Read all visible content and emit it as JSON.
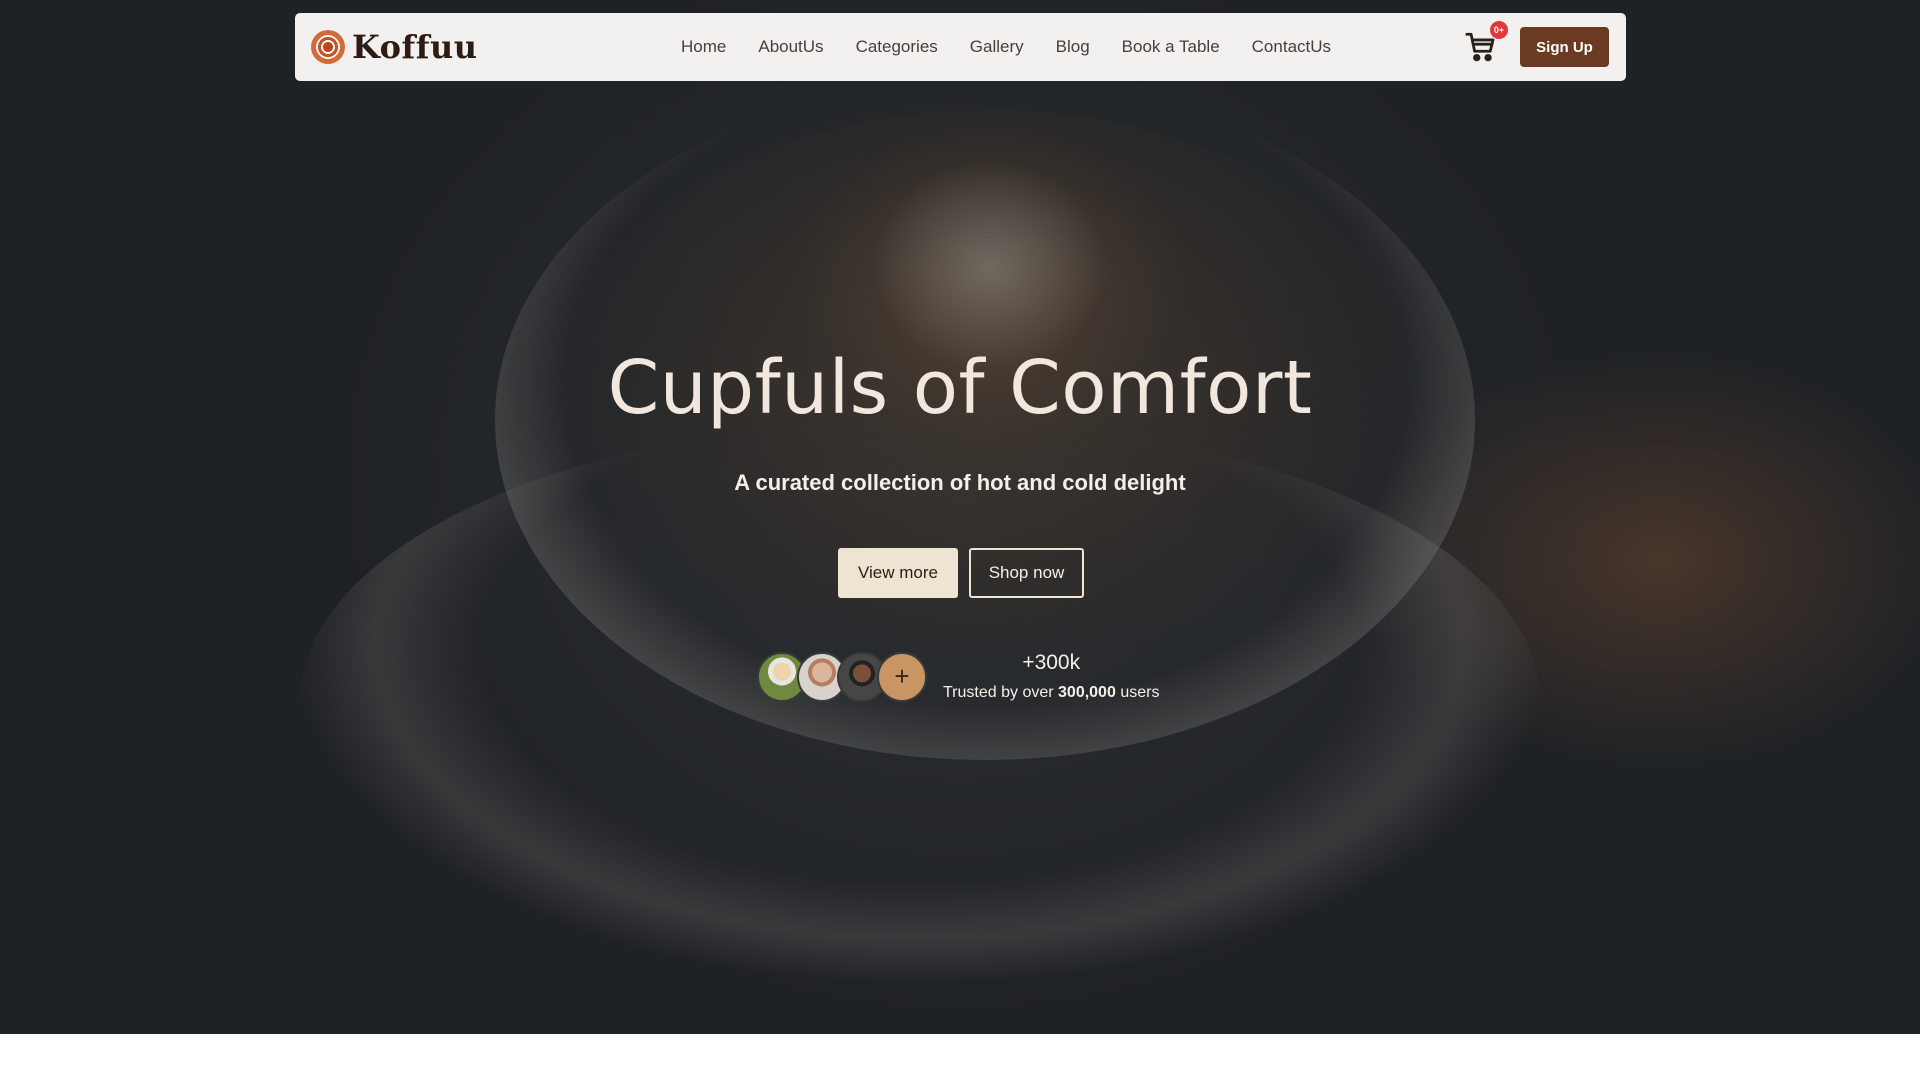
{
  "brand": {
    "name": "Koffuu",
    "logo_icon": "coffee-cup-top-icon"
  },
  "nav": {
    "links": [
      "Home",
      "AboutUs",
      "Categories",
      "Gallery",
      "Blog",
      "Book a Table",
      "ContactUs"
    ],
    "cart_badge": "0+",
    "signup_label": "Sign Up"
  },
  "hero": {
    "title": "Cupfuls of Comfort",
    "subtitle": "A curated collection of hot and cold delight",
    "view_more_label": "View more",
    "shop_now_label": "Shop now",
    "plus_symbol": "+",
    "stat_value": "+300k",
    "trust_prefix": "Trusted by over",
    "trust_number": "300,000",
    "trust_suffix": "users"
  },
  "colors": {
    "brand_brown": "#6a3a22",
    "cream": "#efe3d2",
    "badge_red": "#e0383b",
    "accent_caramel": "#c89563"
  }
}
